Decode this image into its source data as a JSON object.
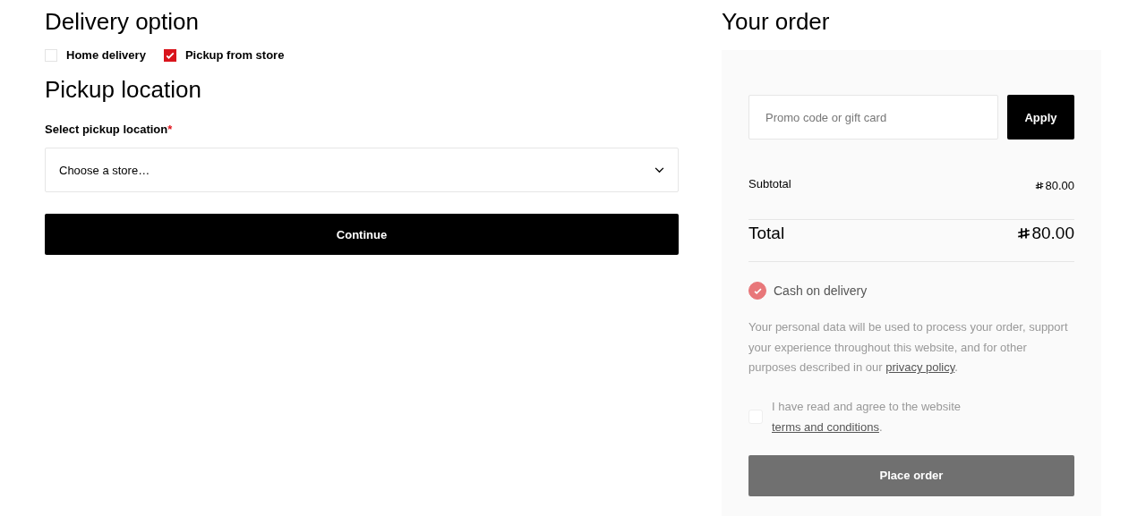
{
  "delivery": {
    "title": "Delivery option",
    "options": [
      {
        "label": "Home delivery",
        "checked": false
      },
      {
        "label": "Pickup from store",
        "checked": true
      }
    ]
  },
  "pickup": {
    "title": "Pickup location",
    "field_label": "Select pickup location",
    "required_mark": "*",
    "placeholder": "Choose a store…"
  },
  "continue_button": "Continue",
  "order": {
    "title": "Your order",
    "promo": {
      "placeholder": "Promo code or gift card",
      "button": "Apply"
    },
    "subtotal": {
      "label": "Subtotal",
      "amount": "80.00"
    },
    "total": {
      "label": "Total",
      "amount": "80.00"
    },
    "payment": {
      "label": "Cash on delivery",
      "checked": true
    },
    "privacy": {
      "before": "Your personal data will be used to process your order, support your experience throughout this website, and for other purposes described in our ",
      "link": "privacy policy",
      "after": "."
    },
    "terms": {
      "before": "I have read and agree to the website ",
      "link": "terms and conditions",
      "after": ".",
      "checked": false
    },
    "place_order": {
      "label": "Place order",
      "disabled": true
    }
  }
}
